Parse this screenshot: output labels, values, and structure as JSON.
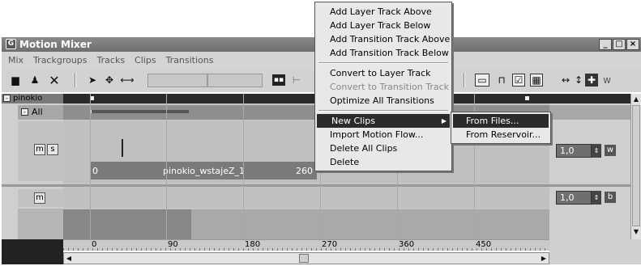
{
  "window": {
    "title": "Motion Mixer"
  },
  "menubar": [
    "Mix",
    "Trackgroups",
    "Tracks",
    "Clips",
    "Transitions"
  ],
  "toolbar": {
    "scale_icons": [
      "↔",
      "↕"
    ],
    "w_label": "w"
  },
  "tracks": {
    "group_name": "pinokio",
    "all_label": "All",
    "track1": {
      "m": "m",
      "s": "s",
      "weight": "1,0",
      "right_btn": "w"
    },
    "track2": {
      "m": "m",
      "weight": "1,0",
      "right_btn": "b"
    }
  },
  "clip": {
    "start": "0",
    "name": "pinokio_wstajeZ_1",
    "end": "260"
  },
  "ruler": {
    "ticks": [
      "0",
      "90",
      "180",
      "270",
      "360",
      "450"
    ]
  },
  "context_menu": {
    "items": [
      {
        "label": "Add Layer Track Above",
        "disabled": false
      },
      {
        "label": "Add Layer Track Below",
        "disabled": false
      },
      {
        "label": "Add Transition Track Above",
        "disabled": false
      },
      {
        "label": "Add Transition Track Below",
        "disabled": false
      },
      {
        "label": "Convert to Layer Track",
        "disabled": false
      },
      {
        "label": "Convert to Transition Track",
        "disabled": true
      },
      {
        "label": "Optimize All Transitions",
        "disabled": false
      },
      {
        "label": "New Clips",
        "disabled": false,
        "highlighted": true
      },
      {
        "label": "Import Motion Flow...",
        "disabled": false
      },
      {
        "label": "Delete All Clips",
        "disabled": false
      },
      {
        "label": "Delete",
        "disabled": false
      }
    ]
  },
  "submenu": {
    "items": [
      {
        "label": "From Files...",
        "highlighted": true
      },
      {
        "label": "From Reservoir..."
      }
    ]
  }
}
